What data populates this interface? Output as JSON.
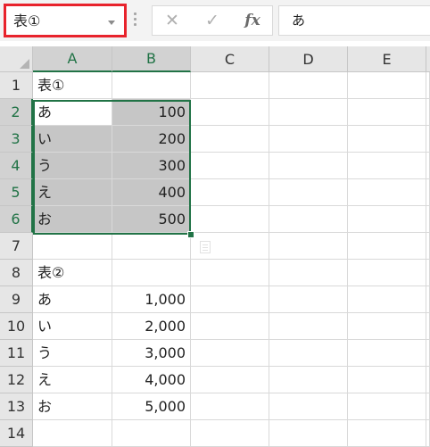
{
  "formula_bar": {
    "name_box_value": "表①",
    "cancel_glyph": "✕",
    "enter_glyph": "✓",
    "fx_label": "fx",
    "formula_value": "あ"
  },
  "accent_color": "#217346",
  "highlight_color": "#e8232c",
  "columns": [
    "A",
    "B",
    "C",
    "D",
    "E"
  ],
  "rows": [
    "1",
    "2",
    "3",
    "4",
    "5",
    "6",
    "7",
    "8",
    "9",
    "10",
    "11",
    "12",
    "13",
    "14"
  ],
  "cells": {
    "A1": "表①",
    "A2": "あ",
    "B2": "100",
    "A3": "い",
    "B3": "200",
    "A4": "う",
    "B4": "300",
    "A5": "え",
    "B5": "400",
    "A6": "お",
    "B6": "500",
    "A8": "表②",
    "A9": "あ",
    "B9": "1,000",
    "A10": "い",
    "B10": "2,000",
    "A11": "う",
    "B11": "3,000",
    "A12": "え",
    "B12": "4,000",
    "A13": "お",
    "B13": "5,000"
  },
  "selected_range": "A2:B6",
  "active_cell": "A2"
}
